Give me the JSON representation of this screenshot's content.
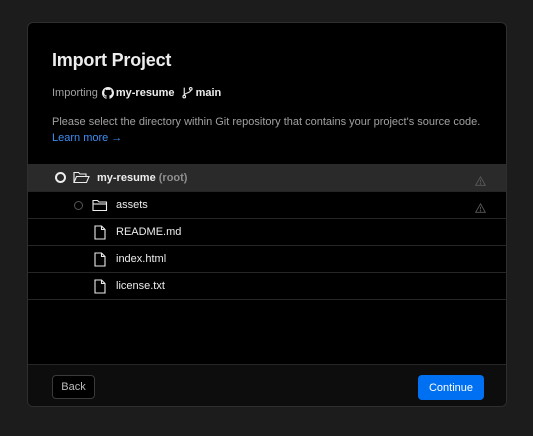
{
  "dialog": {
    "title": "Import Project",
    "importing_prefix": "Importing",
    "repo_name": "my-resume",
    "branch_name": "main",
    "description": "Please select the directory within Git repository that contains your project's source code.",
    "learn_more": "Learn more →"
  },
  "tree": {
    "root": {
      "name": "my-resume",
      "suffix": "(root)"
    },
    "items": [
      {
        "name": "assets"
      },
      {
        "name": "README.md"
      },
      {
        "name": "index.html"
      },
      {
        "name": "license.txt"
      }
    ]
  },
  "footer": {
    "back_label": "Back",
    "continue_label": "Continue"
  },
  "colors": {
    "accent": "#0070f3",
    "link": "#3e8ef5",
    "background": "#000000"
  },
  "icons": {
    "repo": "github-icon",
    "branch": "git-branch-icon",
    "folder_open": "folder-open-icon",
    "folder": "folder-icon",
    "file": "file-icon",
    "warning": "warning-icon"
  }
}
